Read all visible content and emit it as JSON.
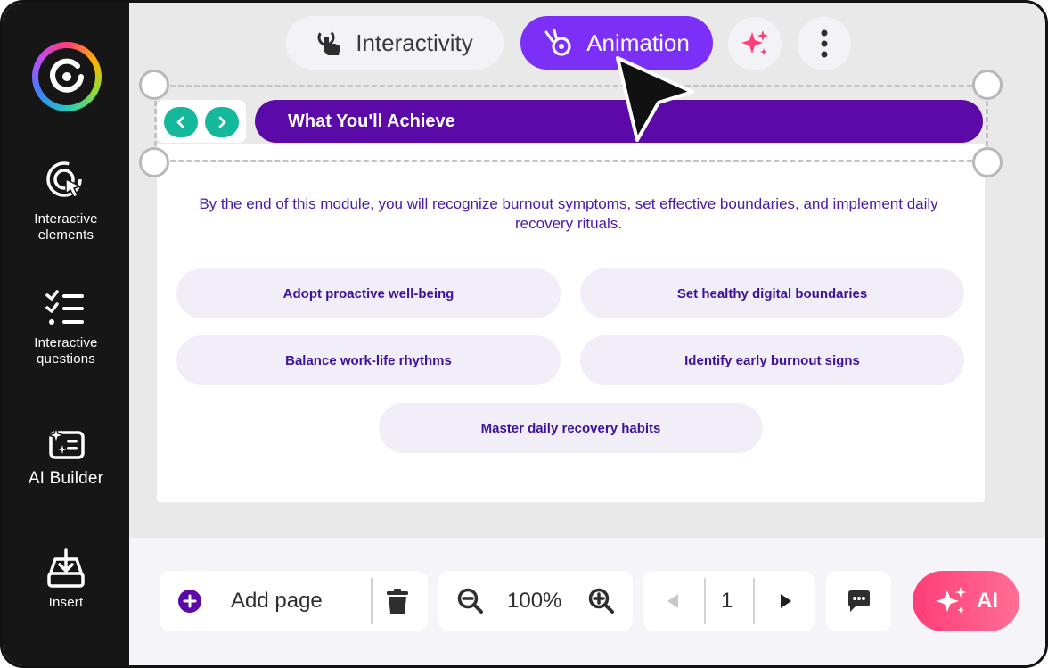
{
  "sidebar": {
    "items": [
      {
        "label": "Interactive elements",
        "icon": "touch-target-icon"
      },
      {
        "label": "Interactive questions",
        "icon": "checklist-icon"
      },
      {
        "label": "AI Builder",
        "icon": "ai-sparkle-list-icon"
      },
      {
        "label": "Insert",
        "icon": "insert-tray-icon"
      }
    ]
  },
  "toolbar": {
    "interactivity_label": "Interactivity",
    "animation_label": "Animation"
  },
  "slide": {
    "title": "What You'll Achieve",
    "intro": "By the end of this module, you will recognize burnout symptoms, set effective boundaries, and implement daily recovery rituals.",
    "goals": [
      "Adopt proactive well-being",
      "Set healthy digital boundaries",
      "Balance work-life rhythms",
      "Identify early burnout signs",
      "Master daily recovery habits"
    ]
  },
  "bottom": {
    "add_page_label": "Add page",
    "zoom_level": "100%",
    "page_number": "1",
    "ai_label": "AI"
  },
  "colors": {
    "accent_purple": "#7b2ff7",
    "title_bar": "#5b0aa8",
    "nav_green": "#14b89a",
    "ai_pink": "#ff3d78"
  }
}
